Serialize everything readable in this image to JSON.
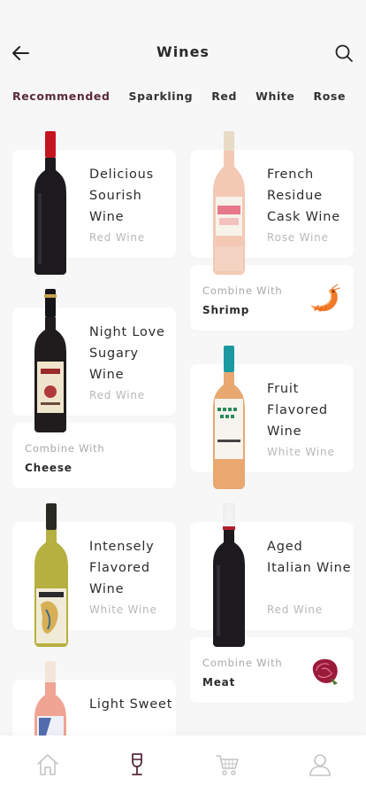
{
  "header": {
    "title": "Wines",
    "back_icon": "arrow-left-icon",
    "search_icon": "search-icon"
  },
  "tabs": [
    {
      "label": "Recommended",
      "active": true
    },
    {
      "label": "Sparkling",
      "active": false
    },
    {
      "label": "Red",
      "active": false
    },
    {
      "label": "White",
      "active": false
    },
    {
      "label": "Rose",
      "active": false
    }
  ],
  "wines": [
    {
      "name": "Delicious Sourish Wine",
      "type": "Red Wine"
    },
    {
      "name": "French Residue Cask Wine",
      "type": "Rose Wine"
    },
    {
      "name": "Night Love Sugary Wine",
      "type": "Red Wine"
    },
    {
      "name": "Fruit Flavored Wine",
      "type": "White Wine"
    },
    {
      "name": "Intensely Flavored Wine",
      "type": "White Wine"
    },
    {
      "name": "Aged Italian Wine",
      "type": "Red Wine"
    },
    {
      "name": "Light Sweet",
      "type": ""
    }
  ],
  "pairings": [
    {
      "label": "Combine With",
      "food": "Shrimp",
      "icon": "shrimp-icon"
    },
    {
      "label": "Combine With",
      "food": "Cheese"
    },
    {
      "label": "Combine With",
      "food": "Meat",
      "icon": "meat-icon"
    }
  ],
  "bottom_nav": [
    {
      "icon": "home-icon",
      "active": false
    },
    {
      "icon": "wine-glass-icon",
      "active": true
    },
    {
      "icon": "cart-icon",
      "active": false
    },
    {
      "icon": "user-icon",
      "active": false
    }
  ],
  "colors": {
    "accent": "#5a2a3e",
    "background": "#f7f7f8",
    "card": "#ffffff",
    "muted_text": "#b8b8b8"
  }
}
